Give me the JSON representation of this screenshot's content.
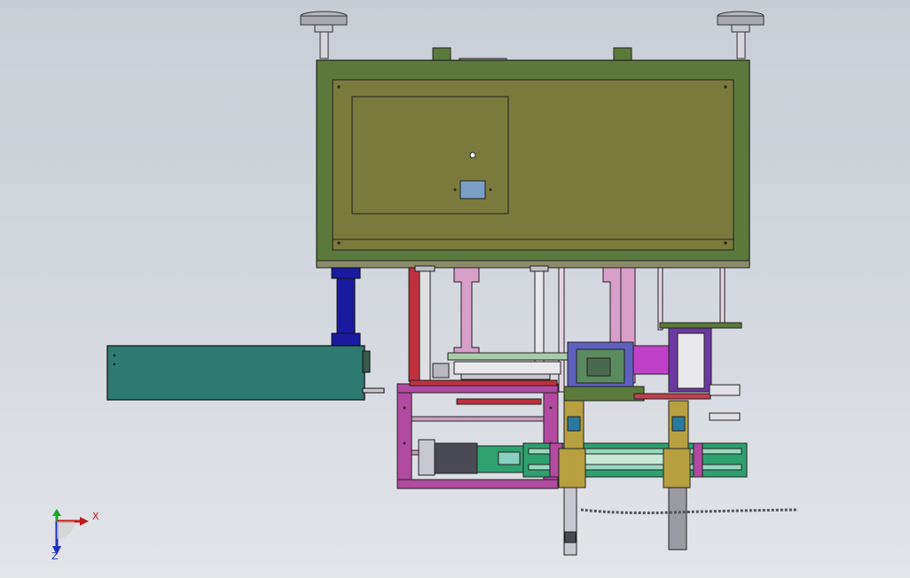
{
  "viewport": {
    "background_top": "#c9ced6",
    "background_bottom": "#e2e4e8"
  },
  "colors": {
    "main_panel": "#7a7a3c",
    "main_frame": "#5c7a3c",
    "blue_column": "#1a1aa0",
    "teal_box": "#2f7a70",
    "magenta_frame": "#b14aa0",
    "pink_bracket": "#d8a0c8",
    "green_rail": "#2fa070",
    "red_rail": "#c0303f",
    "purple_motor": "#c040c8",
    "sight_window": "#7aa0c8"
  },
  "triad": {
    "x_label": "X",
    "z_label": "Z",
    "x_color": "#c0191f",
    "y_color": "#18a82a",
    "z_color": "#1f2fbf"
  }
}
